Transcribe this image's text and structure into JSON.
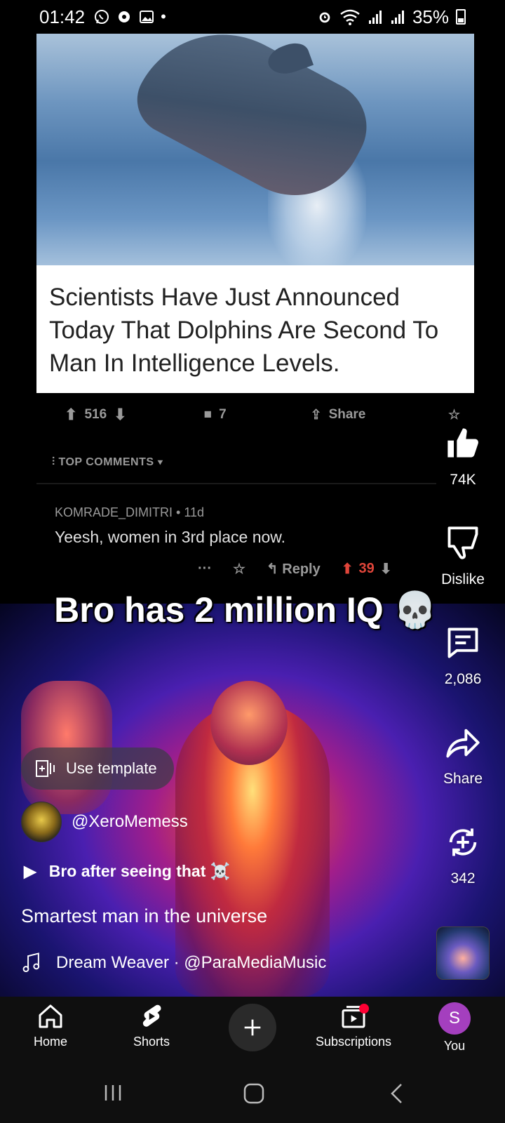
{
  "status_bar": {
    "time": "01:42",
    "battery": "35%",
    "left_icons": [
      "whatsapp-icon",
      "settings-icon",
      "gallery-icon",
      "dot-icon"
    ],
    "right_icons": [
      "alarm-icon",
      "wifi-icon",
      "signal-icon",
      "signal-icon",
      "battery-icon"
    ]
  },
  "video": {
    "headline": "Scientists Have Just Announced Today That Dolphins Are Second To Man In Intelligence Levels.",
    "reddit": {
      "upvotes": "516",
      "comments": "7",
      "share_label": "Share",
      "top_comments_label": "TOP COMMENTS",
      "comment_user": "KOMRADE_DIMITRI • 11d",
      "comment_text": "Yeesh, women in 3rd place now.",
      "more": "···",
      "reply_label": "Reply",
      "comment_votes": "39"
    },
    "overlay_text": "Bro has 2 million IQ 💀"
  },
  "actions": {
    "like_count": "74K",
    "dislike_label": "Dislike",
    "comments_count": "2,086",
    "share_label": "Share",
    "remix_count": "342"
  },
  "info": {
    "template_label": "Use template",
    "channel": "@XeroMemess",
    "subline": "Bro after seeing that ☠️",
    "title": "Smartest man in the universe",
    "music": "Dream Weaver · @ParaMediaMusic"
  },
  "nav": {
    "home": "Home",
    "shorts": "Shorts",
    "subscriptions": "Subscriptions",
    "you": "You",
    "you_initial": "S"
  },
  "colors": {
    "accent_red": "#ff0033",
    "avatar_purple": "#a43fbe",
    "nav_bg": "#0f0f0f"
  }
}
